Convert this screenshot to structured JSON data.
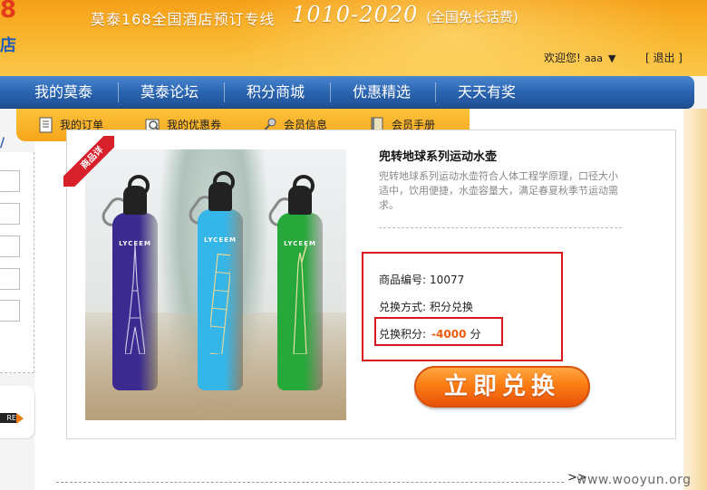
{
  "header": {
    "logo_number": "8",
    "logo_text": "店",
    "hotline_lead": "莫泰168全国酒店预订专线",
    "hotline_number": "1010-2020",
    "hotline_note": "(全国免长话费)",
    "welcome_label": "欢迎您!",
    "username": "aaa",
    "dropdown_icon": "▼",
    "logout_label": "[ 退出 ]"
  },
  "main_nav": [
    {
      "label": "我的莫泰"
    },
    {
      "label": "莫泰论坛"
    },
    {
      "label": "积分商城"
    },
    {
      "label": "优惠精选"
    },
    {
      "label": "天天有奖"
    }
  ],
  "sub_nav": [
    {
      "label": "我的订单",
      "icon": "order-icon"
    },
    {
      "label": "我的优惠券",
      "icon": "coupon-search-icon"
    },
    {
      "label": "会员信息",
      "icon": "member-key-icon"
    },
    {
      "label": "会员手册",
      "icon": "handbook-icon"
    }
  ],
  "sidebar": {
    "v_glyph": "/",
    "badge_text": "RE"
  },
  "product": {
    "ribbon": "商品详",
    "title": "兜转地球系列运动水壶",
    "description": "兜转地球系列运动水壶符合人体工程学原理，口径大小适中，饮用便捷，水壶容量大，满足春夏秋季节运动需求。",
    "bottles": [
      {
        "brand": "LYCEEM",
        "color": "#3b2a8f"
      },
      {
        "brand": "LYCEEM",
        "color": "#35b6e8"
      },
      {
        "brand": "LYCEEM",
        "color": "#27a83a"
      }
    ],
    "code_label": "商品编号:",
    "code_value": "10077",
    "method_label": "兑换方式:",
    "method_value": "积分兑换",
    "points_label": "兑换积分:",
    "points_value": "-4000",
    "points_unit": "分",
    "redeem_button": "立即兑换"
  },
  "footer": {
    "pager_arrow": ">>",
    "watermark": "www.wooyun.org"
  },
  "colors": {
    "header_orange": "#f8b32a",
    "nav_blue": "#2b65b1",
    "subnav_yellow": "#f7a51b",
    "highlight_red": "#d9161d",
    "points_orange": "#ef5a0d",
    "button_orange": "#fb7d12"
  }
}
